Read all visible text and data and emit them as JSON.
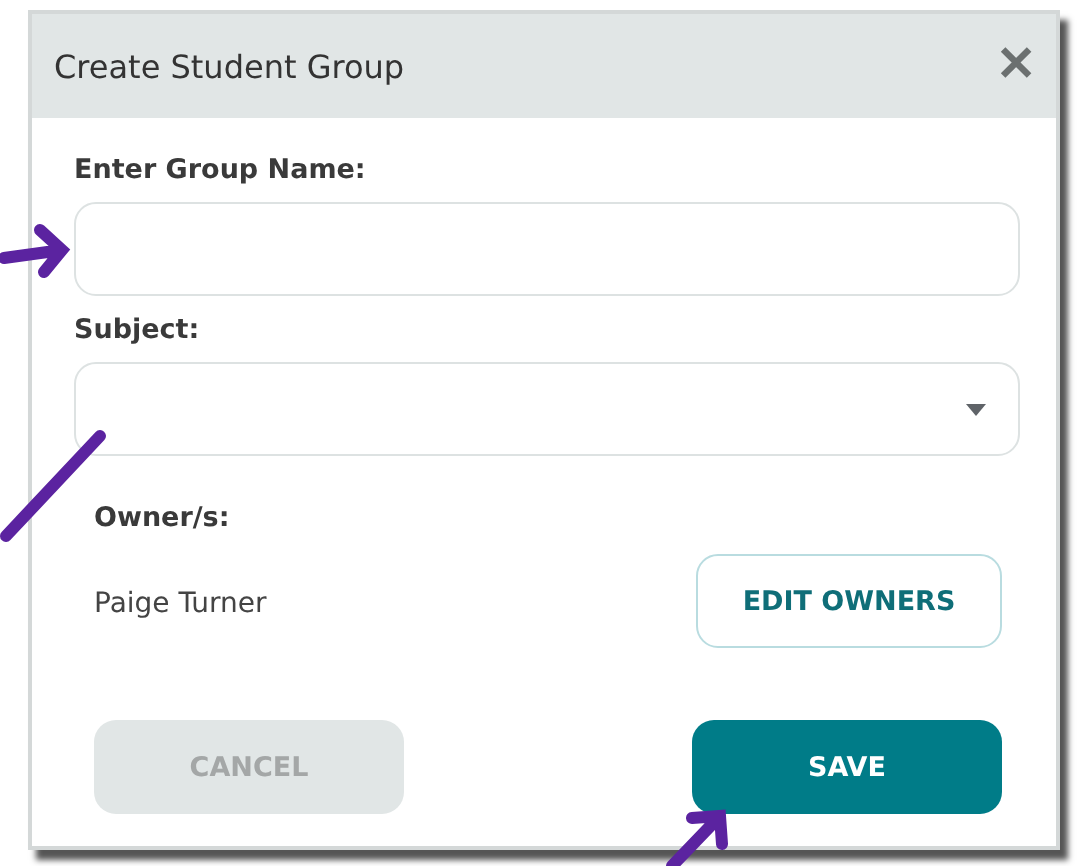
{
  "dialog": {
    "title": "Create Student Group",
    "close": "✕"
  },
  "fields": [
    {
      "kind": "text",
      "label": "Enter Group Name:"
    },
    {
      "kind": "select",
      "label": "Subject:"
    }
  ],
  "owners": {
    "label": "Owner/s:",
    "names": [
      "Paige Turner"
    ],
    "edit_button": "EDIT OWNERS"
  },
  "buttons": [
    {
      "label": "CANCEL",
      "kind": "secondary",
      "disabled": true
    },
    {
      "label": "SAVE",
      "kind": "primary",
      "disabled": false
    }
  ]
}
